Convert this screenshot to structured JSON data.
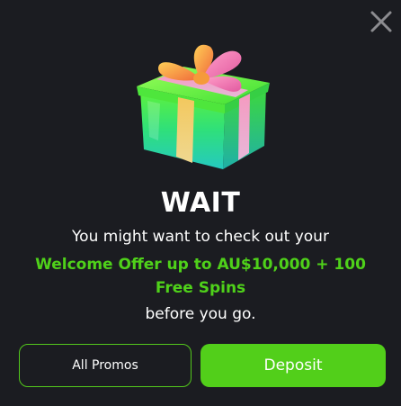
{
  "modal": {
    "title": "WAIT",
    "message_line1": "You might want to check out your",
    "offer_text": "Welcome Offer up to AU$10,000 + 100 Free Spins",
    "message_line3": "before you go.",
    "close_icon": "close-icon",
    "image": "gift-box-icon"
  },
  "buttons": {
    "all_promos": "All Promos",
    "deposit": "Deposit"
  },
  "colors": {
    "background": "#1b1c21",
    "accent_green": "#52cf1a",
    "offer_green": "#4fd11a",
    "text": "#ffffff"
  }
}
